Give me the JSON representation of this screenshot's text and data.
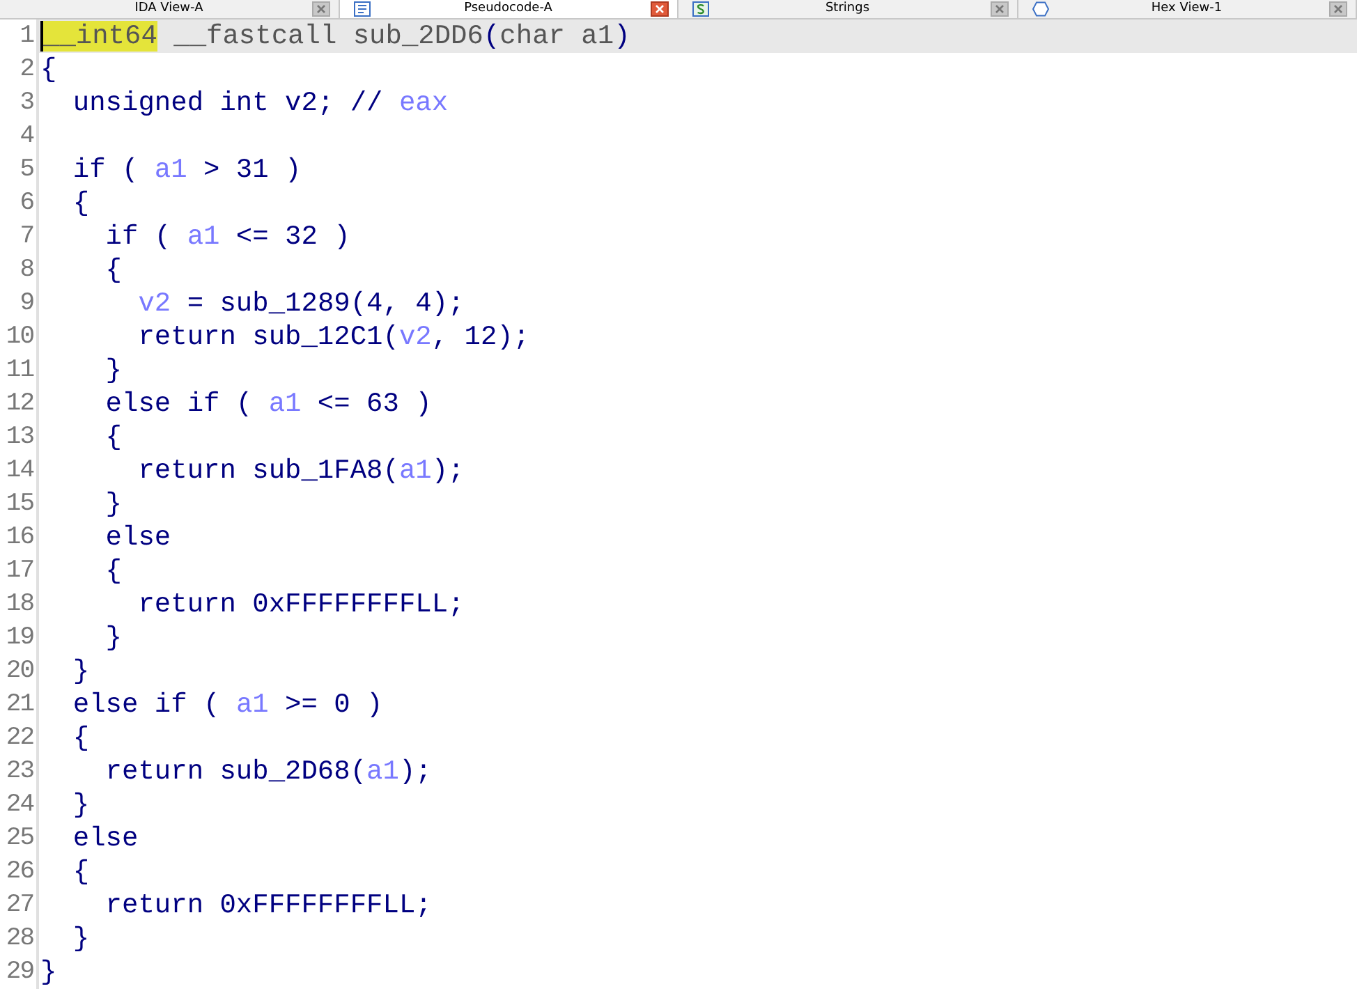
{
  "tabs": [
    {
      "label": "IDA View-A",
      "kind": "disassembly",
      "selected": false
    },
    {
      "label": "Pseudocode-A",
      "kind": "pseudocode",
      "selected": true
    },
    {
      "label": "Strings",
      "kind": "strings",
      "selected": false
    },
    {
      "label": "Hex View-1",
      "kind": "hex",
      "selected": false
    }
  ],
  "lines": [
    {
      "number": "1",
      "current": true,
      "tokens": [
        {
          "text": "__int64",
          "kind": "marked"
        },
        {
          "text": " __fastcall sub_2DD6",
          "kind": "dim"
        },
        {
          "text": "(",
          "kind": "plain"
        },
        {
          "text": "char a1",
          "kind": "dim"
        },
        {
          "text": ")",
          "kind": "plain"
        }
      ]
    },
    {
      "number": "2",
      "current": false,
      "tokens": [
        {
          "text": "{",
          "kind": "plain"
        }
      ]
    },
    {
      "number": "3",
      "current": false,
      "tokens": [
        {
          "text": "  unsigned int v2; // ",
          "kind": "plain"
        },
        {
          "text": "eax",
          "kind": "var"
        }
      ]
    },
    {
      "number": "4",
      "current": false
    },
    {
      "number": "5",
      "current": false,
      "tokens": [
        {
          "text": "  if ( ",
          "kind": "plain"
        },
        {
          "text": "a1",
          "kind": "var"
        },
        {
          "text": " > 31 )",
          "kind": "plain"
        }
      ]
    },
    {
      "number": "6",
      "current": false,
      "tokens": [
        {
          "text": "  {",
          "kind": "plain"
        }
      ]
    },
    {
      "number": "7",
      "current": false,
      "tokens": [
        {
          "text": "    if ( ",
          "kind": "plain"
        },
        {
          "text": "a1",
          "kind": "var"
        },
        {
          "text": " <= 32 )",
          "kind": "plain"
        }
      ]
    },
    {
      "number": "8",
      "current": false,
      "tokens": [
        {
          "text": "    {",
          "kind": "plain"
        }
      ]
    },
    {
      "number": "9",
      "current": false,
      "tokens": [
        {
          "text": "      v2",
          "kind": "var"
        },
        {
          "text": " = sub_1289(4, 4);",
          "kind": "plain"
        }
      ]
    },
    {
      "number": "10",
      "current": false,
      "tokens": [
        {
          "text": "      return sub_12C1(",
          "kind": "plain"
        },
        {
          "text": "v2",
          "kind": "var"
        },
        {
          "text": ", 12);",
          "kind": "plain"
        }
      ]
    },
    {
      "number": "11",
      "current": false,
      "tokens": [
        {
          "text": "    }",
          "kind": "plain"
        }
      ]
    },
    {
      "number": "12",
      "current": false,
      "tokens": [
        {
          "text": "    else if ( ",
          "kind": "plain"
        },
        {
          "text": "a1",
          "kind": "var"
        },
        {
          "text": " <= 63 )",
          "kind": "plain"
        }
      ]
    },
    {
      "number": "13",
      "current": false,
      "tokens": [
        {
          "text": "    {",
          "kind": "plain"
        }
      ]
    },
    {
      "number": "14",
      "current": false,
      "tokens": [
        {
          "text": "      return sub_1FA8(",
          "kind": "plain"
        },
        {
          "text": "a1",
          "kind": "var"
        },
        {
          "text": ");",
          "kind": "plain"
        }
      ]
    },
    {
      "number": "15",
      "current": false,
      "tokens": [
        {
          "text": "    }",
          "kind": "plain"
        }
      ]
    },
    {
      "number": "16",
      "current": false,
      "tokens": [
        {
          "text": "    else",
          "kind": "plain"
        }
      ]
    },
    {
      "number": "17",
      "current": false,
      "tokens": [
        {
          "text": "    {",
          "kind": "plain"
        }
      ]
    },
    {
      "number": "18",
      "current": false,
      "tokens": [
        {
          "text": "      return 0xFFFFFFFFLL;",
          "kind": "plain"
        }
      ]
    },
    {
      "number": "19",
      "current": false,
      "tokens": [
        {
          "text": "    }",
          "kind": "plain"
        }
      ]
    },
    {
      "number": "20",
      "current": false,
      "tokens": [
        {
          "text": "  }",
          "kind": "plain"
        }
      ]
    },
    {
      "number": "21",
      "current": false,
      "tokens": [
        {
          "text": "  else if ( ",
          "kind": "plain"
        },
        {
          "text": "a1",
          "kind": "var"
        },
        {
          "text": " >= 0 )",
          "kind": "plain"
        }
      ]
    },
    {
      "number": "22",
      "current": false,
      "tokens": [
        {
          "text": "  {",
          "kind": "plain"
        }
      ]
    },
    {
      "number": "23",
      "current": false,
      "tokens": [
        {
          "text": "    return sub_2D68(",
          "kind": "plain"
        },
        {
          "text": "a1",
          "kind": "var"
        },
        {
          "text": ");",
          "kind": "plain"
        }
      ]
    },
    {
      "number": "24",
      "current": false,
      "tokens": [
        {
          "text": "  }",
          "kind": "plain"
        }
      ]
    },
    {
      "number": "25",
      "current": false,
      "tokens": [
        {
          "text": "  else",
          "kind": "plain"
        }
      ]
    },
    {
      "number": "26",
      "current": false,
      "tokens": [
        {
          "text": "  {",
          "kind": "plain"
        }
      ]
    },
    {
      "number": "27",
      "current": false,
      "tokens": [
        {
          "text": "    return 0xFFFFFFFFLL;",
          "kind": "plain"
        }
      ]
    },
    {
      "number": "28",
      "current": false,
      "tokens": [
        {
          "text": "  }",
          "kind": "plain"
        }
      ]
    },
    {
      "number": "29",
      "current": false,
      "tokens": [
        {
          "text": "}",
          "kind": "plain"
        }
      ]
    }
  ]
}
